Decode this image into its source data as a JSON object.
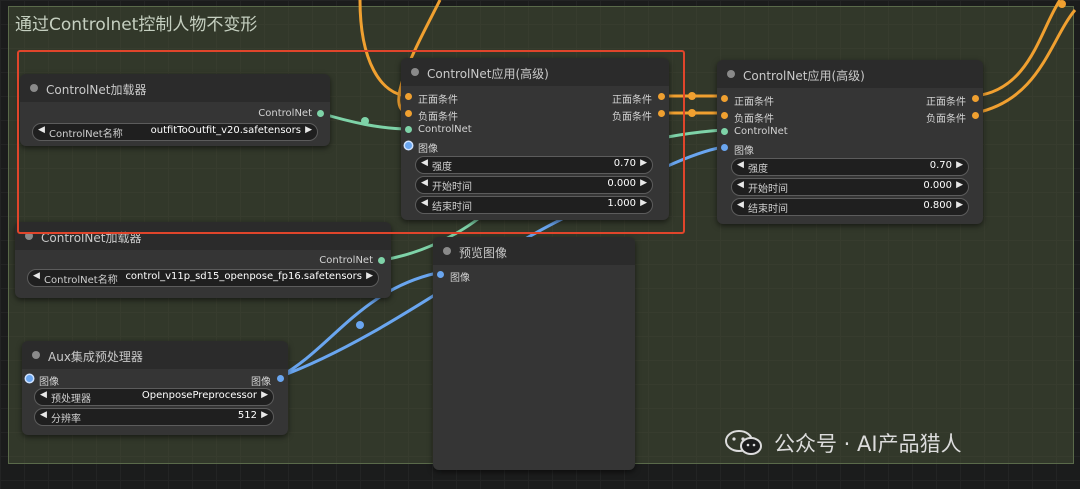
{
  "group": {
    "title": "通过Controlnet控制人物不变形"
  },
  "loader1": {
    "title": "ControlNet加载器",
    "output": "ControlNet",
    "widget": {
      "label": "ControlNet名称",
      "value": "outfitToOutfit_v20.safetensors"
    }
  },
  "apply1": {
    "title": "ControlNet应用(高级)",
    "inputs": [
      "正面条件",
      "负面条件",
      "ControlNet",
      "图像"
    ],
    "outputs": [
      "正面条件",
      "负面条件"
    ],
    "widgets": [
      {
        "label": "强度",
        "value": "0.70"
      },
      {
        "label": "开始时间",
        "value": "0.000"
      },
      {
        "label": "结束时间",
        "value": "1.000"
      }
    ]
  },
  "apply2": {
    "title": "ControlNet应用(高级)",
    "inputs": [
      "正面条件",
      "负面条件",
      "ControlNet",
      "图像"
    ],
    "outputs": [
      "正面条件",
      "负面条件"
    ],
    "widgets": [
      {
        "label": "强度",
        "value": "0.70"
      },
      {
        "label": "开始时间",
        "value": "0.000"
      },
      {
        "label": "结束时间",
        "value": "0.800"
      }
    ]
  },
  "loader2": {
    "title": "ControlNet加载器",
    "output": "ControlNet",
    "widget": {
      "label": "ControlNet名称",
      "value": "control_v11p_sd15_openpose_fp16.safetensors"
    }
  },
  "preview": {
    "title": "预览图像",
    "input": "图像"
  },
  "aux": {
    "title": "Aux集成预处理器",
    "input": "图像",
    "output": "图像",
    "widgets": [
      {
        "label": "预处理器",
        "value": "OpenposePreprocessor"
      },
      {
        "label": "分辨率",
        "value": "512"
      }
    ]
  },
  "watermark": {
    "text": "公众号 · AI产品猎人"
  },
  "icons": {
    "arrow_left": "◀",
    "arrow_right": "▶",
    "wechat": "wechat-icon"
  },
  "colors": {
    "conditioning_wire": "#f0a030",
    "controlnet_wire": "#7ed3a8",
    "image_wire": "#6aa6f0",
    "highlight": "#e0452b",
    "group_fill": "#505c3c"
  }
}
